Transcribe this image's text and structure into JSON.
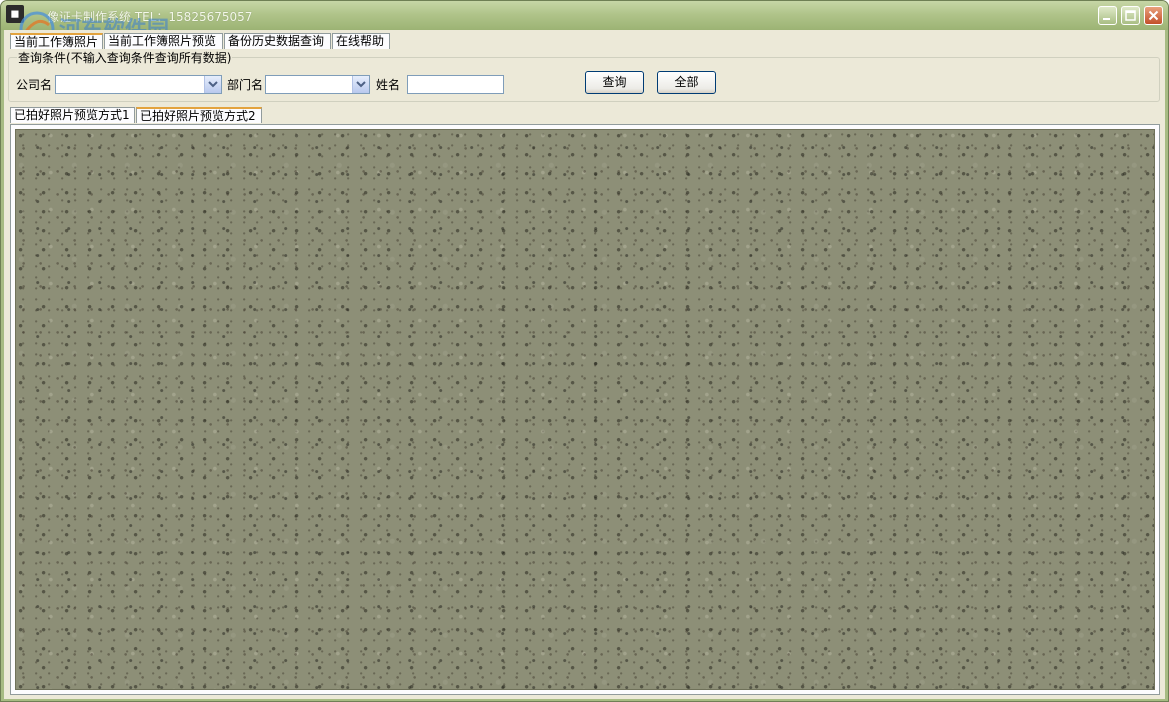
{
  "window": {
    "title": "像证卡制作系统 TEL：15825675057",
    "icon": "app-icon",
    "watermark": "河东软件园",
    "colors": {
      "titlebar": "#a7bb83",
      "client": "#ece9d8",
      "photo_area": "#8d8f77"
    }
  },
  "top_tabs": [
    {
      "label": "当前工作簿照片",
      "active": true
    },
    {
      "label": "当前工作簿照片预览",
      "active": false
    },
    {
      "label": "备份历史数据查询",
      "active": false
    },
    {
      "label": "在线帮助",
      "active": false
    }
  ],
  "query": {
    "legend": "查询条件",
    "hint": "(不输入查询条件查询所有数据)",
    "company_label": "公司名",
    "company_value": "",
    "department_label": "部门名",
    "department_value": "",
    "name_label": "姓名",
    "name_value": "",
    "search_button": "查询",
    "all_button": "全部"
  },
  "preview_tabs": [
    {
      "label": "已拍好照片预览方式1",
      "active": false
    },
    {
      "label": "已拍好照片预览方式2",
      "active": true
    }
  ]
}
